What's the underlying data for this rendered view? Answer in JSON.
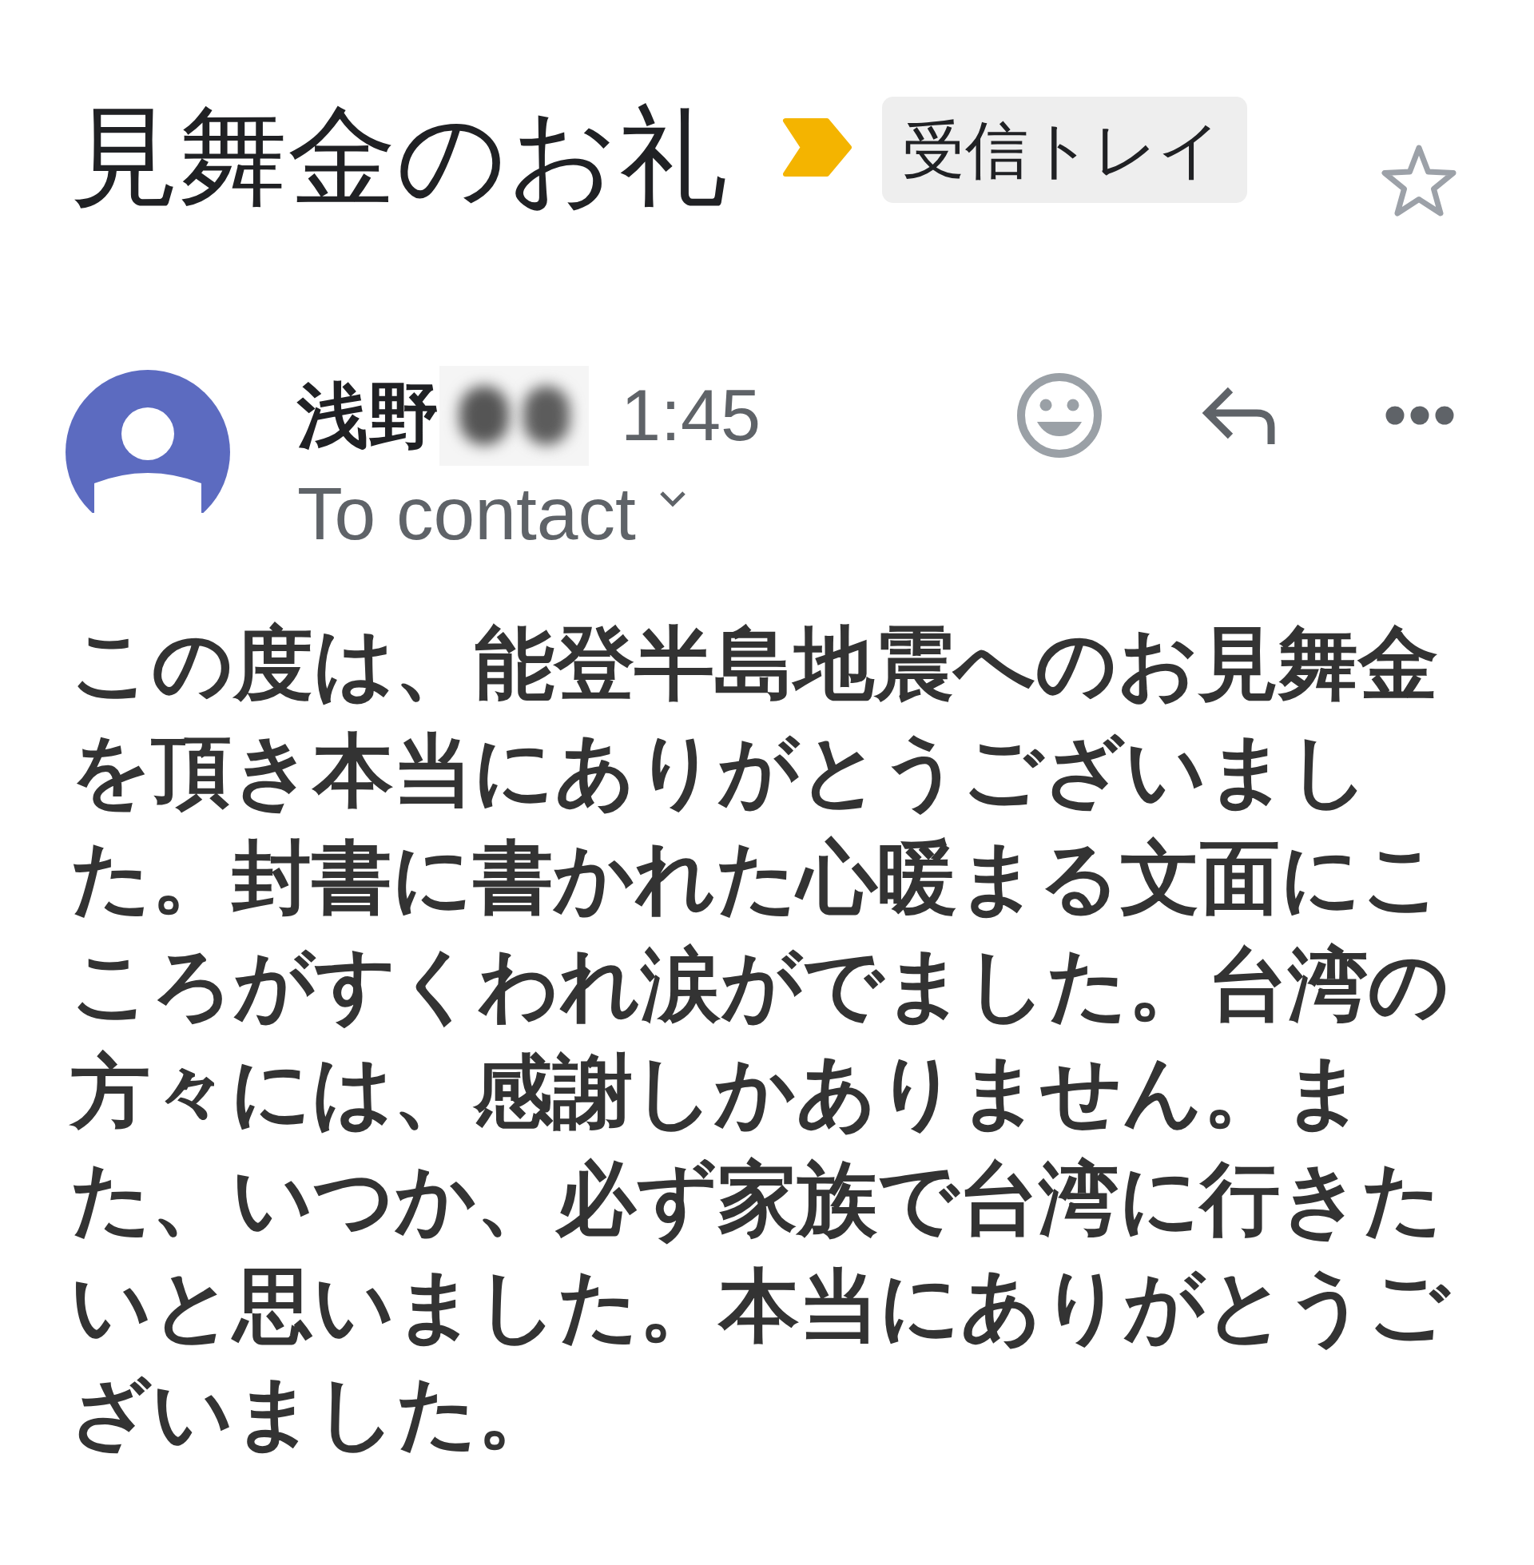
{
  "header": {
    "subject": "見舞金のお礼",
    "important": true,
    "label": "受信トレイ",
    "starred": false
  },
  "message": {
    "sender": {
      "name": "浅野",
      "name_redacted": true
    },
    "time": "1:45",
    "recipient": "To contact",
    "body": "この度は、能登半島地震へのお見舞金を頂き本当にありがとうございました。封書に書かれた心暖まる文面にこころがすくわれ涙がでました。台湾の方々には、感謝しかありません。また、いつか、必ず家族で台湾に行きたいと思いました。本当にありがとうございました。"
  }
}
